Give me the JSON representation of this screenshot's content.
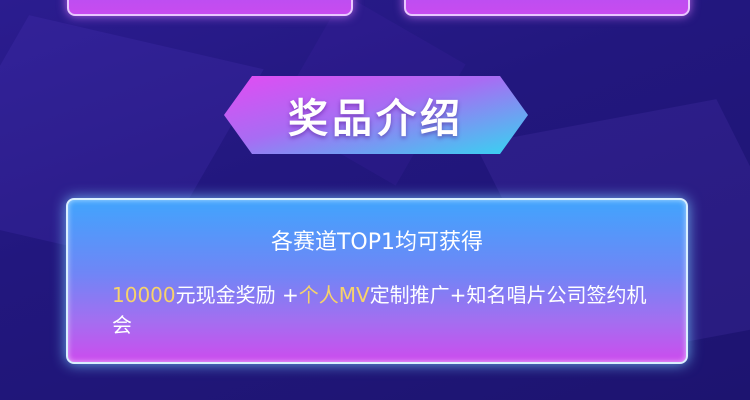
{
  "banner": {
    "title": "奖品介绍"
  },
  "prize": {
    "heading": "各赛道TOP1均可获得",
    "desc_parts": {
      "amount": "10000",
      "cash": "元现金奖励 ",
      "plus1": "+",
      "personal": "个人MV",
      "rest": "定制推广+知名唱片公司签约机会"
    }
  },
  "colors": {
    "background": "#22177e",
    "highlight": "#f7d36a",
    "card_gradient_top": "#41a4fd",
    "card_gradient_bottom": "#cc4cee",
    "banner_gradient_left": "#e24cf3",
    "banner_gradient_right": "#33d6f2"
  }
}
